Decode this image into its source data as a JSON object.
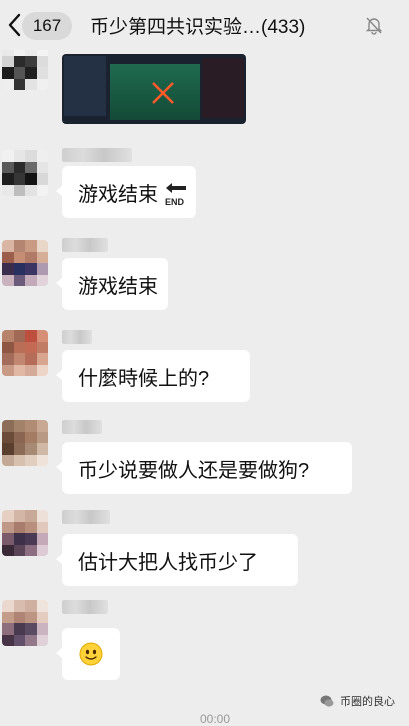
{
  "header": {
    "unread_count": "167",
    "chat_title": "币少第四共识实验…(433)",
    "mute_icon": "bell-muted-icon"
  },
  "messages": [
    {
      "type": "image",
      "icon": "x-mark-icon"
    },
    {
      "type": "text",
      "text": "游戏结束",
      "suffix_icon": "end-arrow-icon",
      "suffix_text": "END"
    },
    {
      "type": "text",
      "text": "游戏结束"
    },
    {
      "type": "text",
      "text": "什麼時候上的?"
    },
    {
      "type": "text",
      "text": "币少说要做人还是要做狗?"
    },
    {
      "type": "text",
      "text": "估计大把人找币少了"
    },
    {
      "type": "emoji",
      "icon": "smiley-face-icon"
    }
  ],
  "watermark": "币圈的良心",
  "bottom_time": "00:00",
  "colors": {
    "background": "#ededed",
    "bubble": "#ffffff",
    "badge": "#d9d9d9"
  }
}
